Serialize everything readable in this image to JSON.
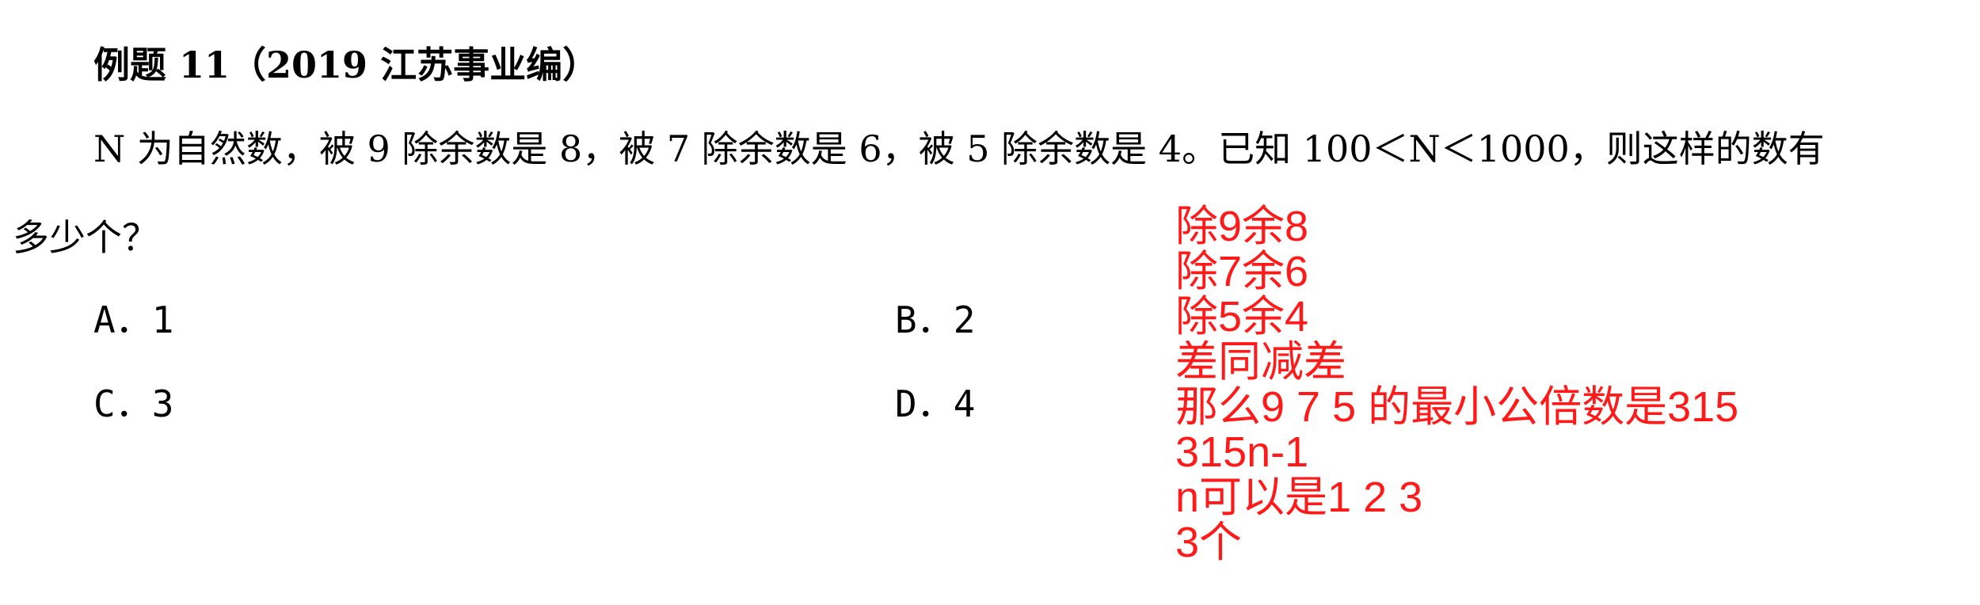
{
  "problem": {
    "title": "例题 11（2019 江苏事业编）",
    "question_line1": "N 为自然数，被 9 除余数是 8，被 7 除余数是 6，被 5 除余数是 4。已知 100＜N＜1000，则这样的数有",
    "question_line2": "多少个？",
    "options": {
      "a": "A．1",
      "b": "B．2",
      "c": "C．3",
      "d": "D．4"
    }
  },
  "annotations": {
    "color": "#ff1a1a",
    "lines": [
      "除9余8",
      "除7余6",
      "除5余4",
      "差同减差",
      "那么9 7 5 的最小公倍数是315",
      "315n-1",
      "n可以是1 2 3",
      "3个"
    ]
  }
}
